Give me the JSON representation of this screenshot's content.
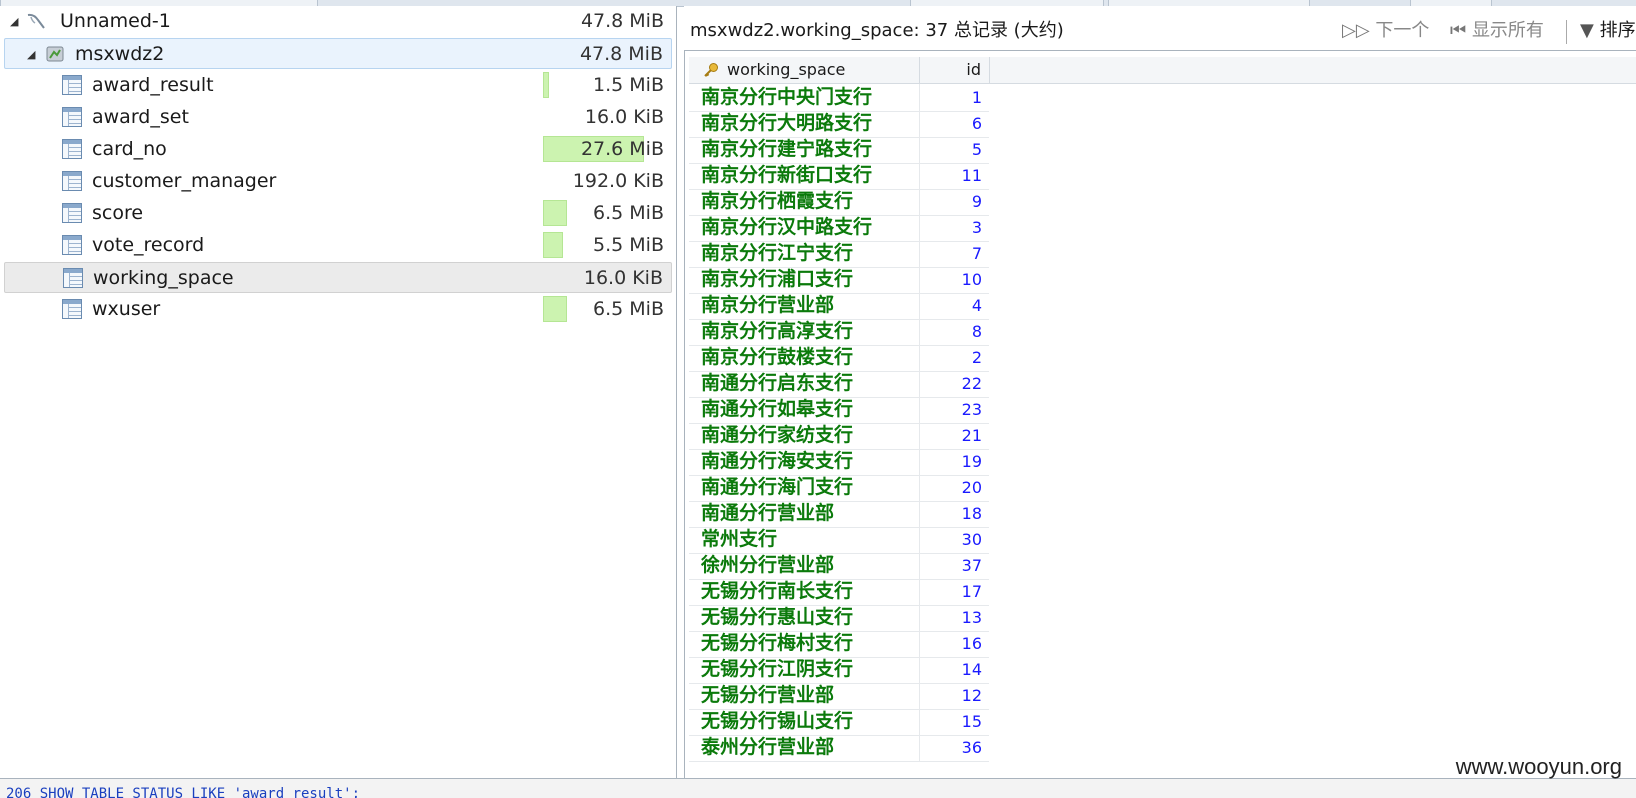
{
  "tree": {
    "root": {
      "label": "Unnamed-1",
      "size": "47.8 MiB"
    },
    "database": {
      "label": "msxwdz2",
      "size": "47.8 MiB"
    },
    "tables": [
      {
        "name": "award_result",
        "size": "1.5 MiB",
        "usage": 0.01
      },
      {
        "name": "award_set",
        "size": "16.0 KiB",
        "usage": 0
      },
      {
        "name": "card_no",
        "size": "27.6 MiB",
        "usage": 1.0
      },
      {
        "name": "customer_manager",
        "size": "192.0 KiB",
        "usage": 0
      },
      {
        "name": "score",
        "size": "6.5 MiB",
        "usage": 0.24
      },
      {
        "name": "vote_record",
        "size": "5.5 MiB",
        "usage": 0.2
      },
      {
        "name": "working_space",
        "size": "16.0 KiB",
        "usage": 0,
        "selected": true
      },
      {
        "name": "wxuser",
        "size": "6.5 MiB",
        "usage": 0.24
      }
    ]
  },
  "result": {
    "title": "msxwdz2.working_space: 37 总记录 (大约)",
    "next_label": "下一个",
    "show_all_label": "显示所有",
    "sort_label": "排序"
  },
  "grid": {
    "columns": [
      "working_space",
      "id"
    ],
    "rows": [
      {
        "ws": "南京分行中央门支行",
        "id": "1"
      },
      {
        "ws": "南京分行大明路支行",
        "id": "6"
      },
      {
        "ws": "南京分行建宁路支行",
        "id": "5"
      },
      {
        "ws": "南京分行新街口支行",
        "id": "11"
      },
      {
        "ws": "南京分行栖霞支行",
        "id": "9"
      },
      {
        "ws": "南京分行汉中路支行",
        "id": "3"
      },
      {
        "ws": "南京分行江宁支行",
        "id": "7"
      },
      {
        "ws": "南京分行浦口支行",
        "id": "10"
      },
      {
        "ws": "南京分行营业部",
        "id": "4"
      },
      {
        "ws": "南京分行高淳支行",
        "id": "8"
      },
      {
        "ws": "南京分行鼓楼支行",
        "id": "2"
      },
      {
        "ws": "南通分行启东支行",
        "id": "22"
      },
      {
        "ws": "南通分行如皋支行",
        "id": "23"
      },
      {
        "ws": "南通分行家纺支行",
        "id": "21"
      },
      {
        "ws": "南通分行海安支行",
        "id": "19"
      },
      {
        "ws": "南通分行海门支行",
        "id": "20"
      },
      {
        "ws": "南通分行营业部",
        "id": "18"
      },
      {
        "ws": "常州支行",
        "id": "30"
      },
      {
        "ws": "徐州分行营业部",
        "id": "37"
      },
      {
        "ws": "无锡分行南长支行",
        "id": "17"
      },
      {
        "ws": "无锡分行惠山支行",
        "id": "13"
      },
      {
        "ws": "无锡分行梅村支行",
        "id": "16"
      },
      {
        "ws": "无锡分行江阴支行",
        "id": "14"
      },
      {
        "ws": "无锡分行营业部",
        "id": "12"
      },
      {
        "ws": "无锡分行锡山支行",
        "id": "15"
      },
      {
        "ws": "泰州分行营业部",
        "id": "36"
      }
    ]
  },
  "status_log": "206 SHOW TABLE STATUS LIKE 'award_result';",
  "watermark": "www.wooyun.org"
}
